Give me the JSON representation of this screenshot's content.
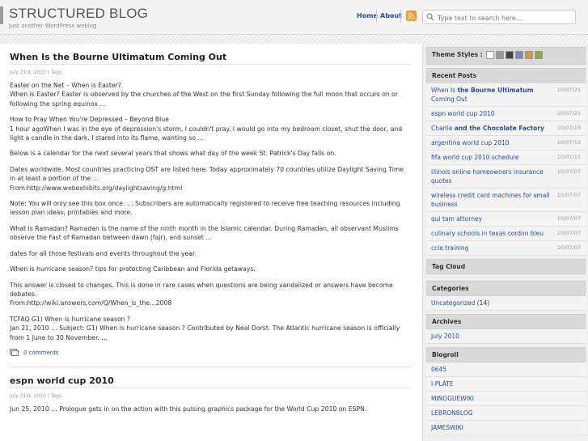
{
  "header": {
    "title": "STRUCTURED BLOG",
    "tagline": "Just another WordPress weblog",
    "nav_home": "Home",
    "nav_about": "About",
    "search_placeholder": "Type text to search here..."
  },
  "posts": [
    {
      "title": "When Is the Bourne Ultimatum Coming Out",
      "meta": "July 21st, 2010 | Tags:",
      "paragraphs": [
        "Easter on the Net – When is Easter?",
        "When is Easter? Easter is observed by the churches of the West on the first Sunday following the full moon that occurs on or following the spring equinox …",
        "How to Pray When You're Depressed – Beyond Blue",
        "1 hour agoWhen I was in the eye of depression's storm, I couldn't pray. I would go into my bedroom closet, shut the door, and light a candle in the dark. I stared into its flame, wanting so …",
        "Below is a calendar for the next several years that shows what day of the week St. Patrick's Day falls on.",
        "Dates worldwide. Most countries practicing DST are listed here. Today approximately 70 countries utilize Daylight Saving Time in at least a portion of the …",
        "From:http://www.webexhibits.org/daylightsaving/g.html",
        "Note: You will only see this box once. … Subscribers are automatically registered to receive free teaching resources including lesson plan ideas, printables and more.",
        "What is Ramadan? Ramadan is the name of the ninth month in the Islamic calendar. During Ramadan, all observant Muslims observe the Fast of Ramadan between dawn (fajr), and sunset …",
        "dates for all those festivals and events throughout the year.",
        "When is hurricane season? tips for protecting Caribbean and Florida getaways.",
        "This answer is closed to changes. This is done in rare cases when questions are being vandalized or answers have become debates.",
        "From:http://wiki.answers.com/Q/When_is_the…2008",
        "TCFAQ G1) When is hurricane season ?",
        "Jan 21, 2010 … Subject: G1) When is hurricane season ? Contributed by Neal Dorst. The Atlantic hurricane season is officially from 1 June to 30 November. …"
      ],
      "comments": "0 comments"
    },
    {
      "title": "espn world cup 2010",
      "meta": "July 21st, 2010 | Tags:",
      "paragraphs": [
        "Jun 25, 2010 … Prologue gets in on the action with this pulsing graphics package for the World Cup 2010 on ESPN."
      ]
    }
  ],
  "sidebar": {
    "theme_label": "Theme Styles :",
    "theme_colors": [
      "#ffffff",
      "#9a9a9a",
      "#444444",
      "#7a8fb0",
      "#c89a4a",
      "#8ea84a"
    ],
    "recent_title": "Recent Posts",
    "recent": [
      {
        "pre": "When Is ",
        "bold": "the Bourne Ultimatum",
        "post": " Coming Out",
        "date": "10/07/21"
      },
      {
        "pre": "espn world cup 2010",
        "bold": "",
        "post": "",
        "date": "10/07/21"
      },
      {
        "pre": "Charlie ",
        "bold": "and the Chocolate Factory",
        "post": "",
        "date": "10/07/19"
      },
      {
        "pre": "argentina world cup 2010",
        "bold": "",
        "post": "",
        "date": "10/07/13"
      },
      {
        "pre": "fifa world cup 2010 schedule",
        "bold": "",
        "post": "",
        "date": "10/07/11"
      },
      {
        "pre": "illinois online homeowners insurance quotes",
        "bold": "",
        "post": "",
        "date": "10/07/07"
      },
      {
        "pre": "wireless credit card machines for small business",
        "bold": "",
        "post": "",
        "date": "10/07/07"
      },
      {
        "pre": "qui tam attorney",
        "bold": "",
        "post": "",
        "date": "10/07/07"
      },
      {
        "pre": "culinary schools in texas cordon bleu",
        "bold": "",
        "post": "",
        "date": "10/07/07"
      },
      {
        "pre": "ccie training",
        "bold": "",
        "post": "",
        "date": "10/07/07"
      }
    ],
    "tagcloud_title": "Tag Cloud",
    "categories_title": "Categories",
    "category": "Uncategorized",
    "category_count": "(14)",
    "archives_title": "Archives",
    "archive": "July 2010",
    "blogroll_title": "Blogroll",
    "blogroll": [
      "0645",
      "I-PLATE",
      "MINOGUEWIKI",
      "LEBRONBLOG",
      "JAMESWIKI"
    ]
  }
}
